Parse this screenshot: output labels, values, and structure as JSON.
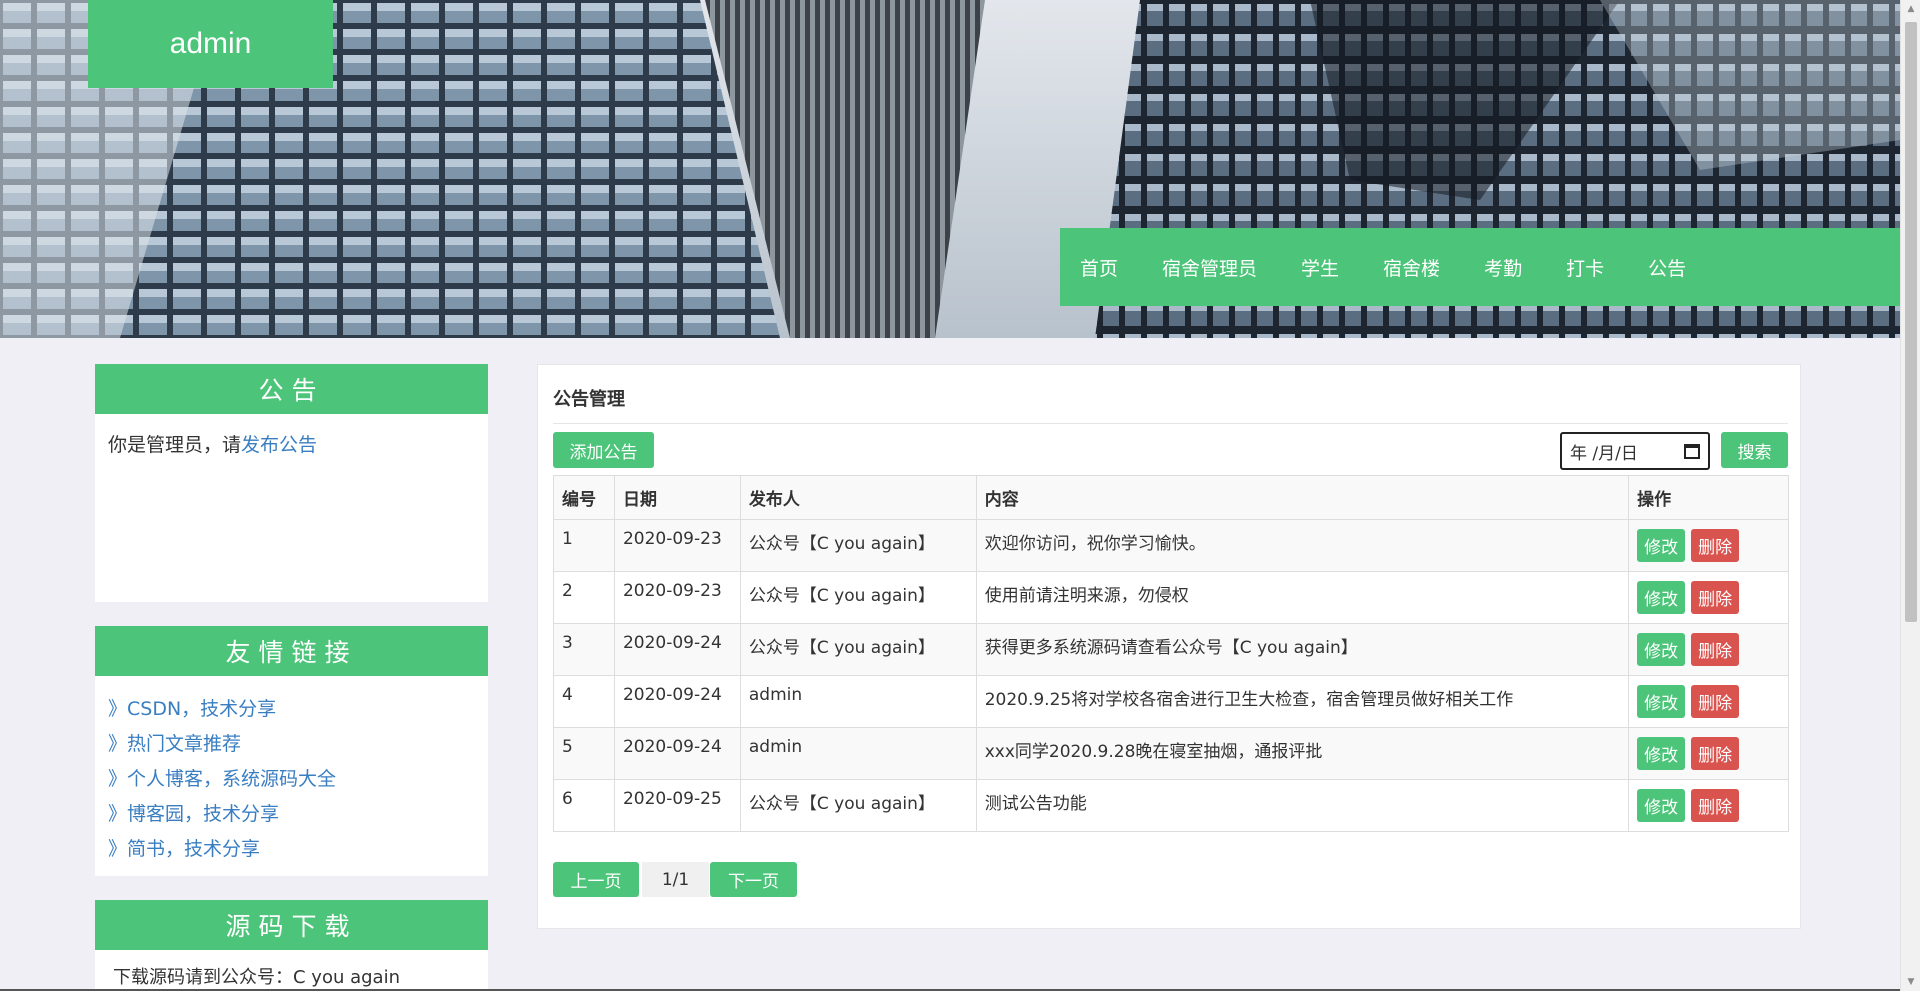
{
  "header": {
    "brand": "admin",
    "nav": [
      "首页",
      "宿舍管理员",
      "学生",
      "宿舍楼",
      "考勤",
      "打卡",
      "公告"
    ]
  },
  "sidebar": {
    "notice": {
      "title": "公告",
      "text_prefix": "你是管理员，请",
      "link": "发布公告"
    },
    "links": {
      "title": "友情链接",
      "items": [
        "》CSDN，技术分享",
        "》热门文章推荐",
        "》个人博客，系统源码大全",
        "》博客园，技术分享",
        "》简书，技术分享"
      ]
    },
    "download": {
      "title": "源码下载",
      "text": "下载源码请到公众号：C you again"
    }
  },
  "main": {
    "title": "公告管理",
    "add_button": "添加公告",
    "date_placeholder": "年 /月/日",
    "search_button": "搜索",
    "columns": [
      "编号",
      "日期",
      "发布人",
      "内容",
      "操作"
    ],
    "rows": [
      {
        "id": "1",
        "date": "2020-09-23",
        "author": "公众号【C you again】",
        "content": "欢迎你访问，祝你学习愉快。"
      },
      {
        "id": "2",
        "date": "2020-09-23",
        "author": "公众号【C you again】",
        "content": "使用前请注明来源，勿侵权"
      },
      {
        "id": "3",
        "date": "2020-09-24",
        "author": "公众号【C you again】",
        "content": "获得更多系统源码请查看公众号【C you again】"
      },
      {
        "id": "4",
        "date": "2020-09-24",
        "author": "admin",
        "content": "2020.9.25将对学校各宿舍进行卫生大检查，宿舍管理员做好相关工作"
      },
      {
        "id": "5",
        "date": "2020-09-24",
        "author": "admin",
        "content": "xxx同学2020.9.28晚在寝室抽烟，通报评批"
      },
      {
        "id": "6",
        "date": "2020-09-25",
        "author": "公众号【C you again】",
        "content": "测试公告功能"
      }
    ],
    "edit_label": "修改",
    "delete_label": "删除",
    "pagination": {
      "prev": "上一页",
      "current": "1/1",
      "next": "下一页"
    }
  },
  "colors": {
    "accent": "#4cc479",
    "danger": "#d9534f",
    "link": "#3a7ec2",
    "page_bg": "#f0eff5"
  }
}
